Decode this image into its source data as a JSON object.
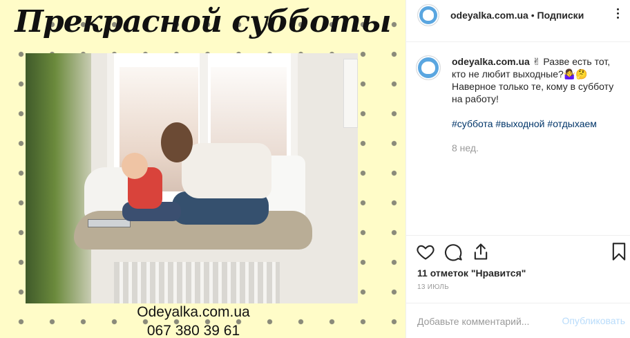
{
  "image": {
    "title": "Прекрасной субботы",
    "site": "Odeyalka.com.ua",
    "phone": "067 380 39 61"
  },
  "header": {
    "username": "odeyalka.com.ua",
    "separator": "•",
    "follow_label": "Подписки",
    "avatar_icon": "cat-logo-icon",
    "more_icon": "more-options-icon"
  },
  "caption": {
    "username": "odeyalka.com.ua",
    "text": " ✌ Разве есть тот, кто не любит выходные?🤷‍♀️🤔 Наверное только те, кому в субботу на работу!",
    "hashtags": [
      "#суббота",
      "#выходной",
      "#отдыхаем"
    ],
    "age": "8 нед."
  },
  "actions": {
    "like_icon": "heart-icon",
    "comment_icon": "comment-icon",
    "share_icon": "share-icon",
    "save_icon": "bookmark-icon"
  },
  "likes": "11 отметок \"Нравится\"",
  "date": "13 ИЮЛЬ",
  "comment_box": {
    "placeholder": "Добавьте комментарий...",
    "publish_label": "Опубликовать"
  },
  "colors": {
    "background_yellow": "#fffcc8",
    "hashtag_blue": "#003569",
    "publish_disabled": "#b9dcfb",
    "muted_gray": "#999999"
  }
}
